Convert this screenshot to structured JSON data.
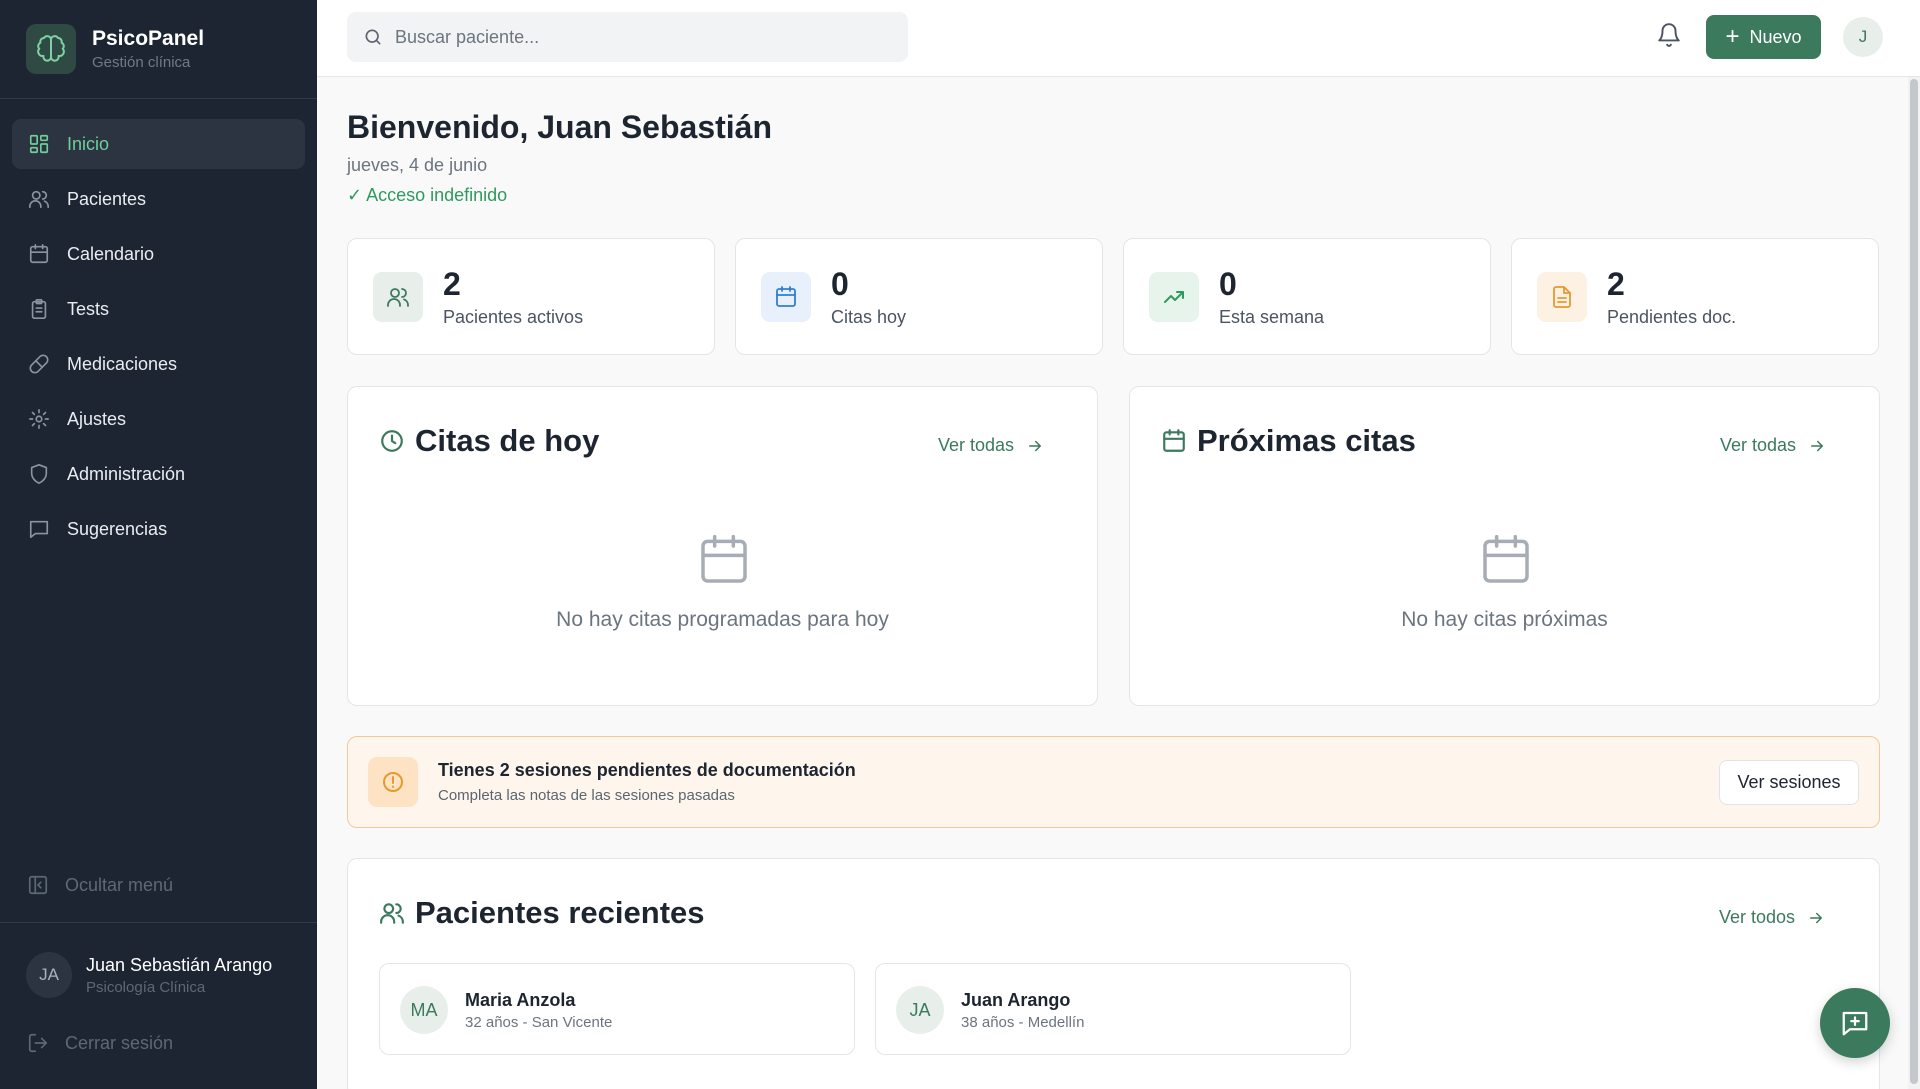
{
  "brand": {
    "name": "PsicoPanel",
    "subtitle": "Gestión clínica"
  },
  "sidebar": {
    "items": [
      {
        "label": "Inicio",
        "icon": "grid-icon",
        "active": true
      },
      {
        "label": "Pacientes",
        "icon": "users-icon"
      },
      {
        "label": "Calendario",
        "icon": "calendar-icon"
      },
      {
        "label": "Tests",
        "icon": "clipboard-icon"
      },
      {
        "label": "Medicaciones",
        "icon": "pill-icon"
      },
      {
        "label": "Ajustes",
        "icon": "gear-icon"
      },
      {
        "label": "Administración",
        "icon": "shield-icon"
      },
      {
        "label": "Sugerencias",
        "icon": "message-icon"
      }
    ],
    "collapse_label": "Ocultar menú",
    "user": {
      "initials": "JA",
      "name": "Juan Sebastián Arango",
      "role": "Psicología Clínica"
    },
    "logout_label": "Cerrar sesión"
  },
  "topbar": {
    "search_placeholder": "Buscar paciente...",
    "new_button": "Nuevo",
    "avatar_initial": "J"
  },
  "header": {
    "welcome": "Bienvenido, Juan Sebastián",
    "date": "jueves, 4 de junio",
    "access": "✓ Acceso indefinido"
  },
  "stats": [
    {
      "value": "2",
      "label": "Pacientes activos",
      "icon": "users-icon"
    },
    {
      "value": "0",
      "label": "Citas hoy",
      "icon": "calendar-icon"
    },
    {
      "value": "0",
      "label": "Esta semana",
      "icon": "trending-up-icon"
    },
    {
      "value": "2",
      "label": "Pendientes doc.",
      "icon": "document-icon"
    }
  ],
  "today_panel": {
    "title": "Citas de hoy",
    "link": "Ver todas",
    "empty": "No hay citas programadas para hoy"
  },
  "upcoming_panel": {
    "title": "Próximas citas",
    "link": "Ver todas",
    "empty": "No hay citas próximas"
  },
  "alert": {
    "title": "Tienes 2 sesiones pendientes de documentación",
    "subtitle": "Completa las notas de las sesiones pasadas",
    "button": "Ver sesiones"
  },
  "recent_patients": {
    "title": "Pacientes recientes",
    "link": "Ver todos",
    "items": [
      {
        "initials": "MA",
        "name": "Maria Anzola",
        "meta": "32 años - San Vicente"
      },
      {
        "initials": "JA",
        "name": "Juan Arango",
        "meta": "38 años - Medellín"
      }
    ]
  },
  "colors": {
    "accent": "#3b7a5c",
    "sidebar_bg": "#1d2532",
    "active_nav": "#6fcf9a",
    "warning": "#f0a030"
  }
}
